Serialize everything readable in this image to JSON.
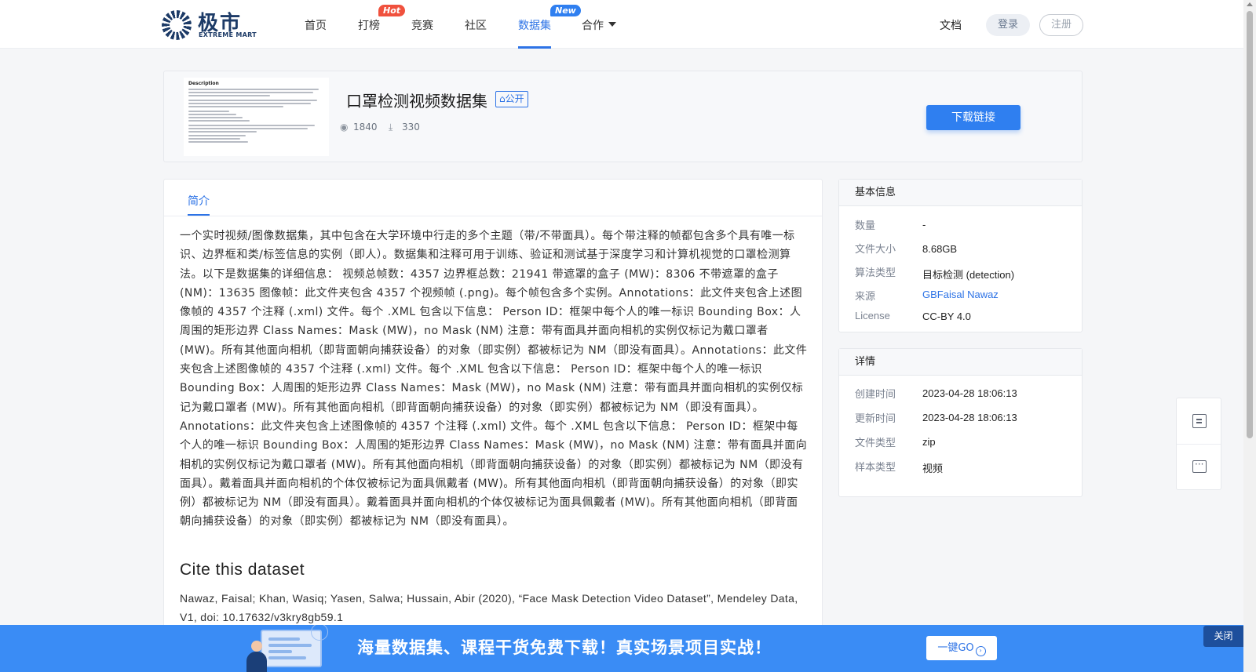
{
  "nav": {
    "logo_cn": "极市",
    "logo_en": "EXTREME MART",
    "items": [
      "首页",
      "打榜",
      "竞赛",
      "社区",
      "数据集",
      "合作"
    ],
    "badge_hot": "Hot",
    "badge_new": "New",
    "docs": "文档",
    "login": "登录",
    "register": "注册"
  },
  "dataset": {
    "title": "口罩检测视频数据集",
    "visibility": "公开",
    "views": "1840",
    "downloads": "330",
    "download_button": "下载链接",
    "thumbnail_heading": "Description"
  },
  "main": {
    "tab": "简介",
    "description": "一个实时视频/图像数据集，其中包含在大学环境中行走的多个主题（带/不带面具）。每个带注释的帧都包含多个具有唯一标识、边界框和类/标签信息的实例（即人）。数据集和注释可用于训练、验证和测试基于深度学习和计算机视觉的口罩检测算法。以下是数据集的详细信息： 视频总帧数：4357 边界框总数：21941 带遮罩的盒子 (MW)：8306 不带遮罩的盒子 (NM)：13635 图像帧：此文件夹包含 4357 个视频帧 (.png)。每个帧包含多个实例。Annotations：此文件夹包含上述图像帧的 4357 个注释 (.xml) 文件。每个 .XML 包含以下信息： Person ID：框架中每个人的唯一标识 Bounding Box：人周围的矩形边界 Class Names：Mask (MW)，no Mask (NM) 注意：带有面具并面向相机的实例仅标记为戴口罩者 (MW)。所有其他面向相机（即背面朝向捕获设备）的对象（即实例）都被标记为 NM（即没有面具）。Annotations：此文件夹包含上述图像帧的 4357 个注释 (.xml) 文件。每个 .XML 包含以下信息： Person ID：框架中每个人的唯一标识 Bounding Box：人周围的矩形边界 Class Names：Mask (MW)，no Mask (NM) 注意：带有面具并面向相机的实例仅标记为戴口罩者 (MW)。所有其他面向相机（即背面朝向捕获设备）的对象（即实例）都被标记为 NM（即没有面具）。Annotations：此文件夹包含上述图像帧的 4357 个注释 (.xml) 文件。每个 .XML 包含以下信息： Person ID：框架中每个人的唯一标识 Bounding Box：人周围的矩形边界 Class Names：Mask (MW)，no Mask (NM) 注意：带有面具并面向相机的实例仅标记为戴口罩者 (MW)。所有其他面向相机（即背面朝向捕获设备）的对象（即实例）都被标记为 NM（即没有面具）。戴着面具并面向相机的个体仅被标记为面具佩戴者 (MW)。所有其他面向相机（即背面朝向捕获设备）的对象（即实例）都被标记为 NM（即没有面具）。戴着面具并面向相机的个体仅被标记为面具佩戴者 (MW)。所有其他面向相机（即背面朝向捕获设备）的对象（即实例）都被标记为 NM（即没有面具）。",
    "cite_title": "Cite this dataset",
    "cite_text": "Nawaz, Faisal; Khan, Wasiq; Yasen, Salwa; Hussain, Abir (2020), “Face Mask Detection Video Dataset”, Mendeley Data, V1, doi: 10.17632/v3kry8gb59.1"
  },
  "basic_info": {
    "heading": "基本信息",
    "rows": [
      {
        "label": "数量",
        "value": "-"
      },
      {
        "label": "文件大小",
        "value": "8.68GB"
      },
      {
        "label": "算法类型",
        "value": "目标检测 (detection)"
      },
      {
        "label": "来源",
        "value": "GBFaisal Nawaz"
      },
      {
        "label": "License",
        "value": "CC-BY 4.0"
      }
    ]
  },
  "details": {
    "heading": "详情",
    "rows": [
      {
        "label": "创建时间",
        "value": "2023-04-28 18:06:13"
      },
      {
        "label": "更新时间",
        "value": "2023-04-28 18:06:13"
      },
      {
        "label": "文件类型",
        "value": "zip"
      },
      {
        "label": "样本类型",
        "value": "视频"
      }
    ]
  },
  "banner": {
    "text": "海量数据集、课程干货免费下载！真实场景项目实战！",
    "go_button": "一键GO",
    "close": "关闭"
  },
  "colors": {
    "accent": "#2d73e6",
    "banner": "#3a8cf5",
    "hot_badge": "#f0513d"
  },
  "icons": [
    "eye-icon",
    "download-icon",
    "lock-icon",
    "notes-icon",
    "chat-icon",
    "chevron-down-icon",
    "arrow-right-circle-icon"
  ]
}
